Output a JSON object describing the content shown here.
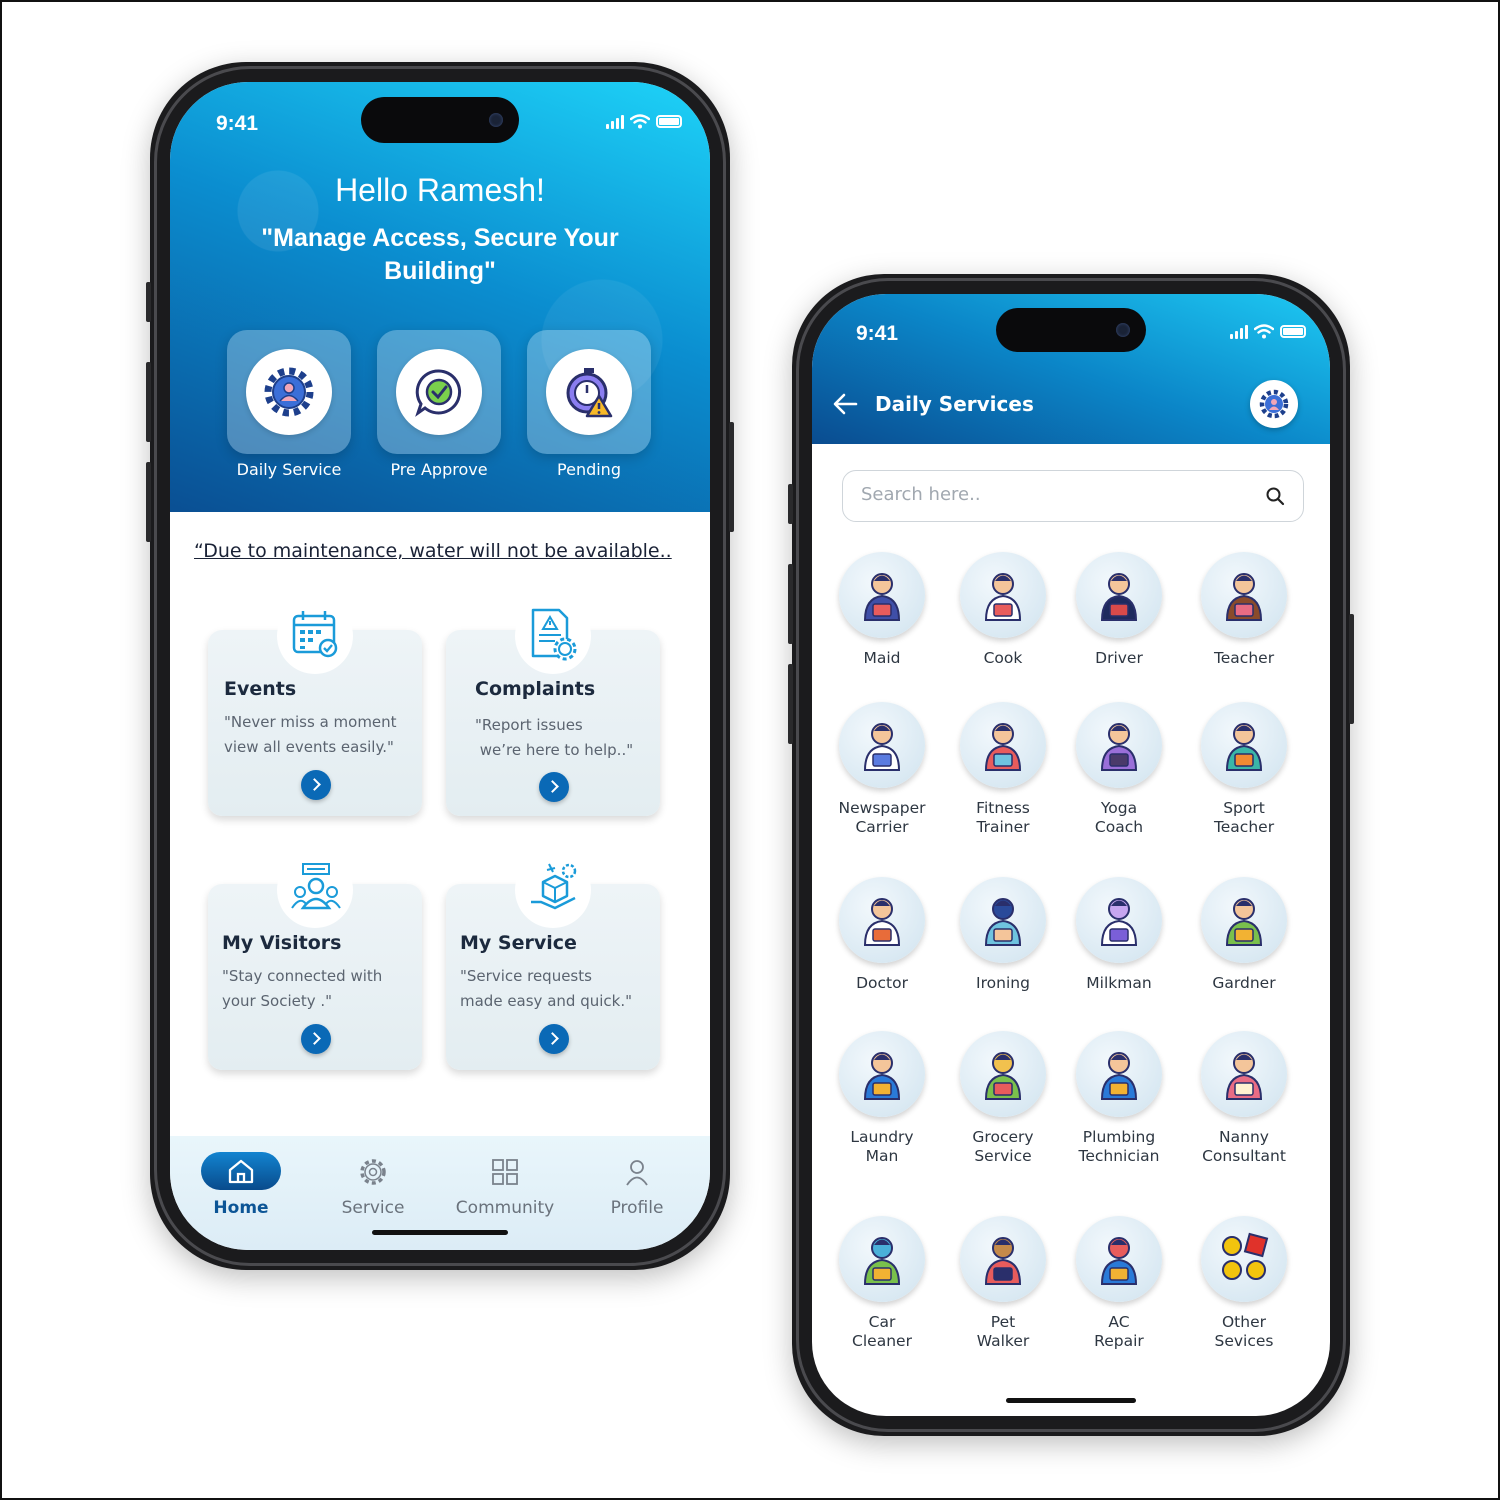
{
  "colors": {
    "primary": "#0a69b6",
    "hero_top": "#1ed3f8",
    "hero_bottom": "#0a4f93"
  },
  "screen1": {
    "status_time": "9:41",
    "greeting": "Hello Ramesh!",
    "tagline": "\"Manage Access, Secure Your Building\"",
    "quick_actions": [
      {
        "label": "Daily Service",
        "icon": "user-gear-icon"
      },
      {
        "label": "Pre Approve",
        "icon": "chat-check-icon"
      },
      {
        "label": "Pending",
        "icon": "timer-warning-icon"
      }
    ],
    "notice": "“Due to maintenance, water will not be available..",
    "cards": [
      {
        "title": "Events",
        "text": "\"Never miss a moment\nview all events easily.\"",
        "icon": "calendar-icon"
      },
      {
        "title": "Complaints",
        "text": "\"Report issues\n we’re here to help..\"",
        "icon": "report-icon"
      },
      {
        "title": "My Visitors",
        "text": "\"Stay connected with\nyour Society .\"",
        "icon": "visitors-icon"
      },
      {
        "title": "My Service",
        "text": "\"Service requests\nmade easy and quick.\"",
        "icon": "service-box-icon"
      }
    ],
    "tabs": [
      {
        "label": "Home",
        "icon": "home-icon",
        "active": true
      },
      {
        "label": "Service",
        "icon": "gear-icon"
      },
      {
        "label": "Community",
        "icon": "grid-icon"
      },
      {
        "label": "Profile",
        "icon": "person-icon"
      }
    ]
  },
  "screen2": {
    "status_time": "9:41",
    "title": "Daily Services",
    "search_placeholder": "Search here..",
    "services": [
      {
        "label": "Maid",
        "icon": "maid-icon"
      },
      {
        "label": "Cook",
        "icon": "cook-icon"
      },
      {
        "label": "Driver",
        "icon": "driver-icon"
      },
      {
        "label": "Teacher",
        "icon": "teacher-icon"
      },
      {
        "label": "Newspaper\nCarrier",
        "icon": "newspaper-icon"
      },
      {
        "label": "Fitness\nTrainer",
        "icon": "fitness-icon"
      },
      {
        "label": "Yoga\nCoach",
        "icon": "yoga-icon"
      },
      {
        "label": "Sport\nTeacher",
        "icon": "sport-icon"
      },
      {
        "label": "Doctor",
        "icon": "doctor-icon"
      },
      {
        "label": "Ironing",
        "icon": "ironing-icon"
      },
      {
        "label": "Milkman",
        "icon": "milk-icon"
      },
      {
        "label": "Gardner",
        "icon": "gardener-icon"
      },
      {
        "label": "Laundry\nMan",
        "icon": "laundry-icon"
      },
      {
        "label": "Grocery\nService",
        "icon": "grocery-icon"
      },
      {
        "label": "Plumbing\nTechnician",
        "icon": "plumber-icon"
      },
      {
        "label": "Nanny\nConsultant",
        "icon": "nanny-icon"
      },
      {
        "label": "Car\nCleaner",
        "icon": "car-cleaner-icon"
      },
      {
        "label": "Pet\nWalker",
        "icon": "pet-walker-icon"
      },
      {
        "label": "AC\nRepair",
        "icon": "ac-repair-icon"
      },
      {
        "label": "Other\nSevices",
        "icon": "other-services-icon"
      }
    ]
  }
}
